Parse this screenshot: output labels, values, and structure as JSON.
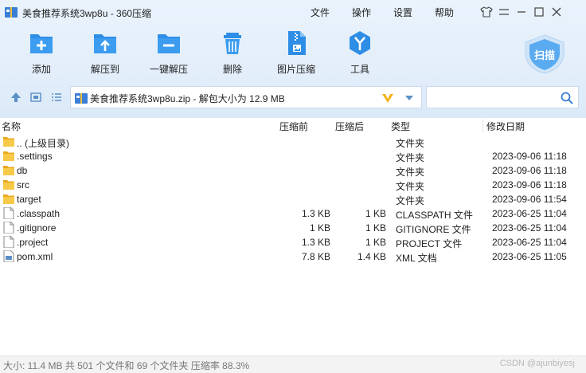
{
  "window": {
    "title": "美食推荐系统3wp8u - 360压缩"
  },
  "menu": {
    "file": "文件",
    "operate": "操作",
    "settings": "设置",
    "help": "帮助"
  },
  "toolbar": {
    "add": "添加",
    "extract_to": "解压到",
    "one_click_extract": "一键解压",
    "delete": "删除",
    "image_compress": "图片压缩",
    "tools": "工具",
    "scan": "扫描"
  },
  "address": {
    "path": "美食推荐系统3wp8u.zip - 解包大小为 12.9 MB"
  },
  "columns": {
    "name": "名称",
    "packed": "压缩前",
    "unpacked": "压缩后",
    "type": "类型",
    "modified": "修改日期"
  },
  "files": [
    {
      "name": ".. (上级目录)",
      "packed": "",
      "unpacked": "",
      "type": "文件夹",
      "date": "",
      "icon": "folder-icon"
    },
    {
      "name": ".settings",
      "packed": "",
      "unpacked": "",
      "type": "文件夹",
      "date": "2023-09-06 11:18",
      "icon": "folder-icon"
    },
    {
      "name": "db",
      "packed": "",
      "unpacked": "",
      "type": "文件夹",
      "date": "2023-09-06 11:18",
      "icon": "folder-icon"
    },
    {
      "name": "src",
      "packed": "",
      "unpacked": "",
      "type": "文件夹",
      "date": "2023-09-06 11:18",
      "icon": "folder-icon"
    },
    {
      "name": "target",
      "packed": "",
      "unpacked": "",
      "type": "文件夹",
      "date": "2023-09-06 11:54",
      "icon": "folder-icon"
    },
    {
      "name": ".classpath",
      "packed": "1.3 KB",
      "unpacked": "1 KB",
      "type": "CLASSPATH 文件",
      "date": "2023-06-25 11:04",
      "icon": "file-icon"
    },
    {
      "name": ".gitignore",
      "packed": "1 KB",
      "unpacked": "1 KB",
      "type": "GITIGNORE 文件",
      "date": "2023-06-25 11:04",
      "icon": "file-icon"
    },
    {
      "name": ".project",
      "packed": "1.3 KB",
      "unpacked": "1 KB",
      "type": "PROJECT 文件",
      "date": "2023-06-25 11:04",
      "icon": "file-icon"
    },
    {
      "name": "pom.xml",
      "packed": "7.8 KB",
      "unpacked": "1.4 KB",
      "type": "XML 文档",
      "date": "2023-06-25 11:05",
      "icon": "xml-file-icon"
    }
  ],
  "status": {
    "text": "大小: 11.4 MB 共 501 个文件和 69 个文件夹 压缩率 88.3%",
    "watermark": "CSDN @ajunbiyesj"
  },
  "colors": {
    "accent": "#2e8ee6",
    "folder": "#f5c242",
    "toolbar_bg": "#e3eefa"
  }
}
